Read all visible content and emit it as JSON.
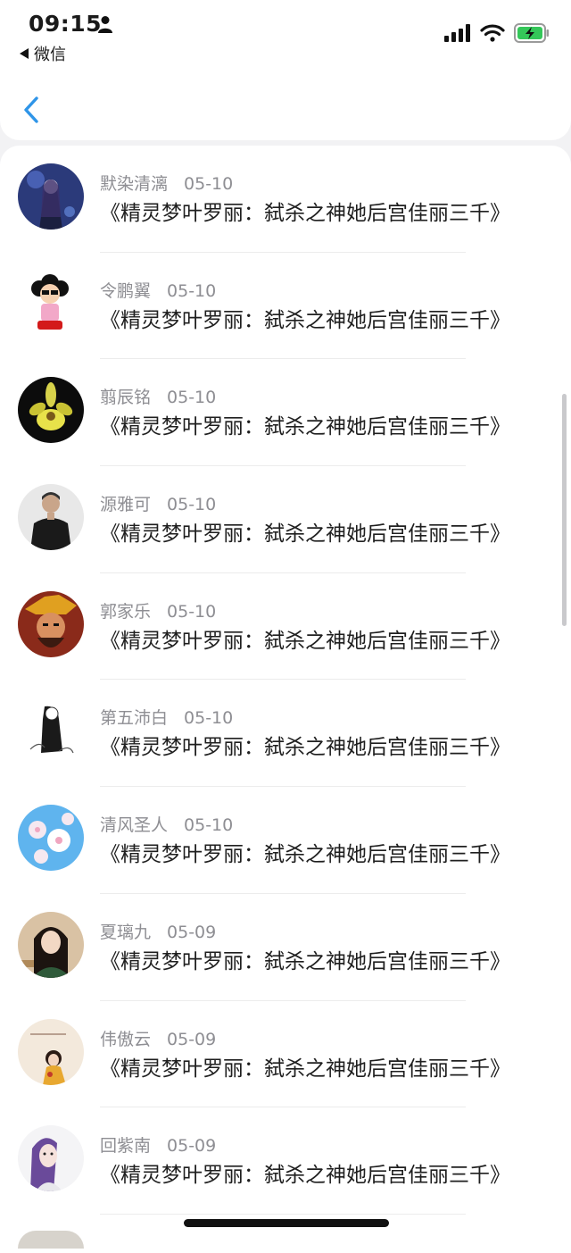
{
  "status_bar": {
    "time": "09:15",
    "back_app_label": "微信",
    "icons": [
      "person-icon",
      "signal-icon",
      "wifi-icon",
      "battery-charging-icon"
    ],
    "battery_color": "#34c759"
  },
  "nav": {
    "back_icon": "chevron-left-icon",
    "accent": "#2f95e8"
  },
  "list": {
    "items": [
      {
        "name": "默染清漓",
        "date": "05-10",
        "message": "《精灵梦叶罗丽：弑杀之神她后宫佳丽三千》",
        "avatar_icon": "anime-girl-avatar"
      },
      {
        "name": "令鹏翼",
        "date": "05-10",
        "message": "《精灵梦叶罗丽：弑杀之神她后宫佳丽三千》",
        "avatar_icon": "cartoon-character-avatar"
      },
      {
        "name": "翦辰铭",
        "date": "05-10",
        "message": "《精灵梦叶罗丽：弑杀之神她后宫佳丽三千》",
        "avatar_icon": "yellow-flower-avatar"
      },
      {
        "name": "源雅可",
        "date": "05-10",
        "message": "《精灵梦叶罗丽：弑杀之神她后宫佳丽三千》",
        "avatar_icon": "man-portrait-avatar"
      },
      {
        "name": "郭家乐",
        "date": "05-10",
        "message": "《精灵梦叶罗丽：弑杀之神她后宫佳丽三千》",
        "avatar_icon": "game-hero-avatar"
      },
      {
        "name": "第五沛白",
        "date": "05-10",
        "message": "《精灵梦叶罗丽：弑杀之神她后宫佳丽三千》",
        "avatar_icon": "sketch-figure-avatar"
      },
      {
        "name": "清风圣人",
        "date": "05-10",
        "message": "《精灵梦叶罗丽：弑杀之神她后宫佳丽三千》",
        "avatar_icon": "cherry-blossom-avatar"
      },
      {
        "name": "夏璃九",
        "date": "05-09",
        "message": "《精灵梦叶罗丽：弑杀之神她后宫佳丽三千》",
        "avatar_icon": "girl-photo-avatar"
      },
      {
        "name": "伟傲云",
        "date": "05-09",
        "message": "《精灵梦叶罗丽：弑杀之神她后宫佳丽三千》",
        "avatar_icon": "illustrated-girl-avatar"
      },
      {
        "name": "回紫南",
        "date": "05-09",
        "message": "《精灵梦叶罗丽：弑杀之神她后宫佳丽三千》",
        "avatar_icon": "purple-hair-girl-avatar"
      }
    ]
  }
}
